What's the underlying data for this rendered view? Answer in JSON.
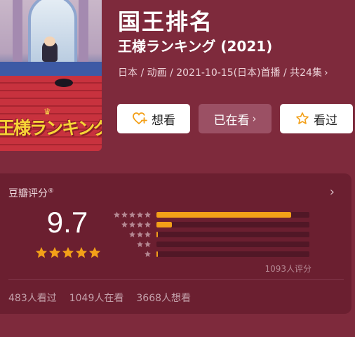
{
  "header": {
    "title": "国王排名",
    "original_title": "王様ランキング (2021)",
    "meta_text": "日本 / 动画 / 2021-10-15(日本)首播 / 共24集",
    "poster_title": "王様ランキング"
  },
  "actions": {
    "want_label": "想看",
    "doing_label": "已在看",
    "done_label": "看过"
  },
  "rating": {
    "label": "豆瓣评分",
    "registered_mark": "®",
    "score": "9.7",
    "stars": 5,
    "distribution": [
      {
        "stars": 5,
        "fraction": 0.88
      },
      {
        "stars": 4,
        "fraction": 0.1
      },
      {
        "stars": 3,
        "fraction": 0.01
      },
      {
        "stars": 2,
        "fraction": 0.0
      },
      {
        "stars": 1,
        "fraction": 0.005
      }
    ],
    "ratings_count_text": "1093人评分"
  },
  "stats": {
    "watched": "483人看过",
    "watching": "1049人在看",
    "want": "3668人想看"
  },
  "colors": {
    "background": "#7e2a3c",
    "card": "#6b1f30",
    "accent_orange": "#f3a018",
    "poster_title_yellow": "#f6d436"
  },
  "icons": {
    "want": "heart-plus-icon",
    "done": "star-outline-icon",
    "card_more": "chevron-right-icon"
  }
}
